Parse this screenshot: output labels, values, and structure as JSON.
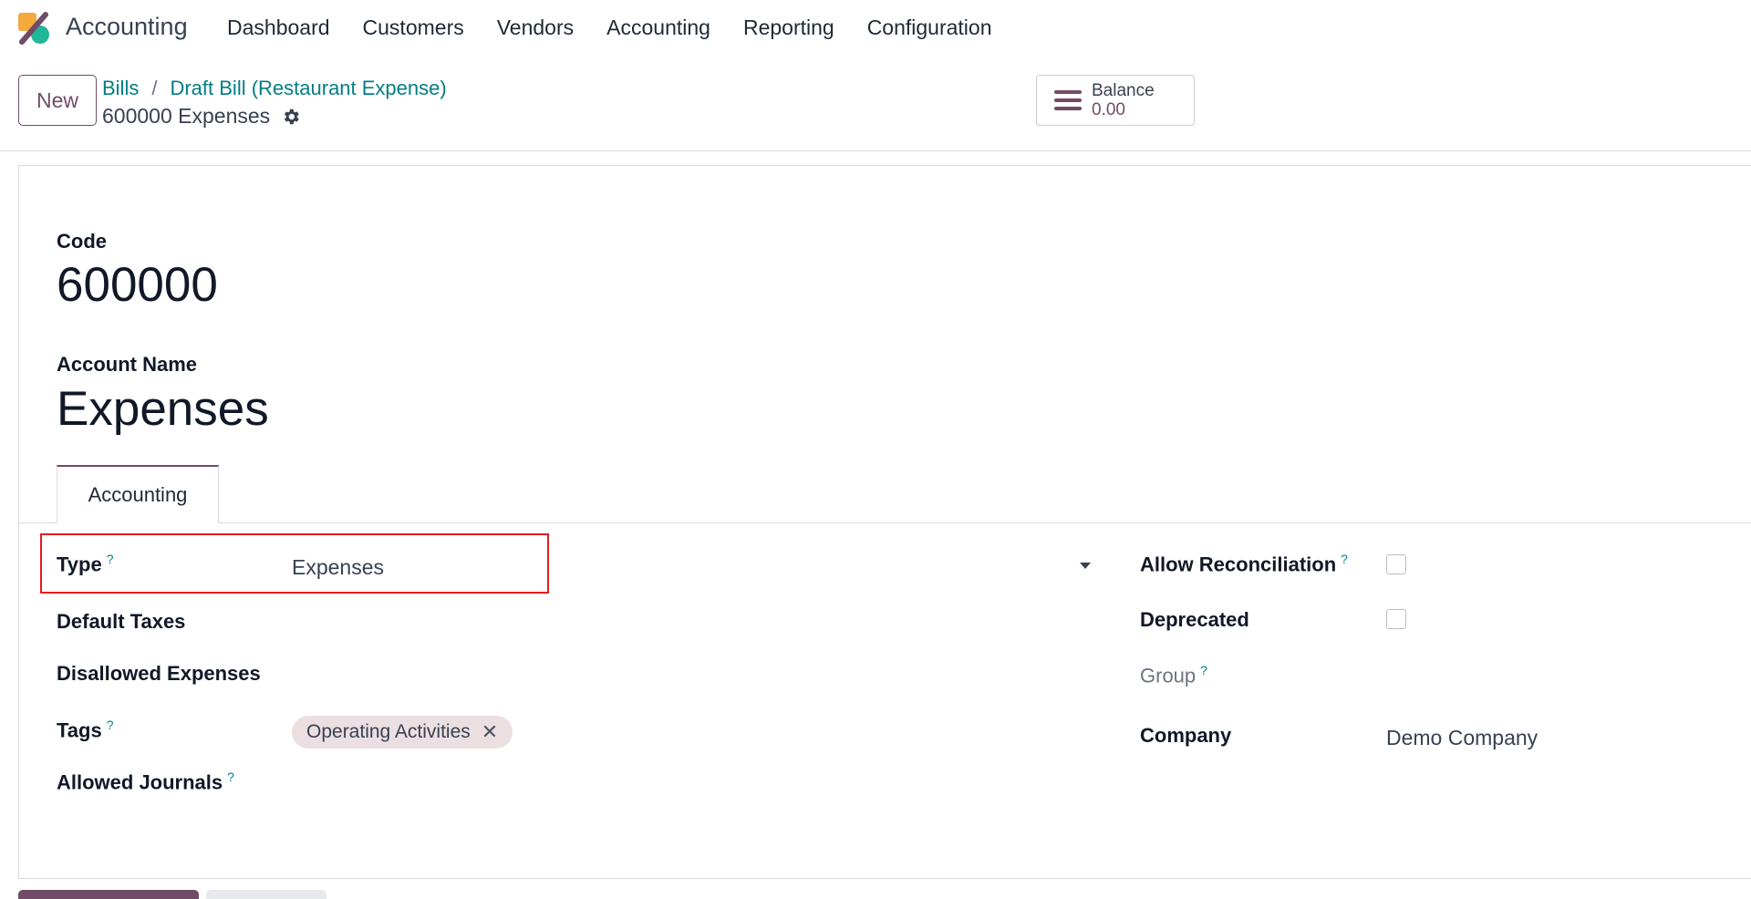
{
  "navbar": {
    "app_name": "Accounting",
    "menu": [
      "Dashboard",
      "Customers",
      "Vendors",
      "Accounting",
      "Reporting",
      "Configuration"
    ]
  },
  "control_panel": {
    "new_label": "New",
    "breadcrumb": [
      "Bills",
      "Draft Bill (Restaurant Expense)"
    ],
    "breadcrumb_separator": "/",
    "record_title": "600000 Expenses",
    "balance_label": "Balance",
    "balance_value": "0.00"
  },
  "form": {
    "code_label": "Code",
    "code_value": "600000",
    "name_label": "Account Name",
    "name_value": "Expenses",
    "tabs": [
      "Accounting"
    ],
    "left_fields": {
      "type_label": "Type",
      "type_value": "Expenses",
      "default_taxes_label": "Default Taxes",
      "disallowed_expenses_label": "Disallowed Expenses",
      "tags_label": "Tags",
      "tags": [
        "Operating Activities"
      ],
      "allowed_journals_label": "Allowed Journals"
    },
    "right_fields": {
      "allow_reconciliation_label": "Allow Reconciliation",
      "allow_reconciliation_checked": false,
      "deprecated_label": "Deprecated",
      "deprecated_checked": false,
      "group_label": "Group",
      "company_label": "Company",
      "company_value": "Demo Company"
    },
    "help_mark": "?",
    "tag_remove_glyph": "✕"
  },
  "colors": {
    "brand": "#714b67",
    "link": "#017e84",
    "highlight": "#e11d22",
    "tag_bg": "#ecdfe2"
  }
}
